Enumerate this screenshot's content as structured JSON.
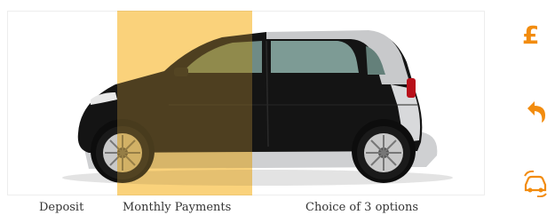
{
  "labels": {
    "deposit": "Deposit",
    "monthly": "Monthly Payments",
    "choice": "Choice of 3 options"
  },
  "icons": {
    "pound": "£",
    "pound_name": "pound-icon",
    "undo_name": "undo-arrow-icon",
    "car_name": "car-swap-icon"
  },
  "colors": {
    "accent": "#f28c0f",
    "highlight": "#f6b21f",
    "car_body": "#111111",
    "car_silver": "#d9dadb"
  }
}
